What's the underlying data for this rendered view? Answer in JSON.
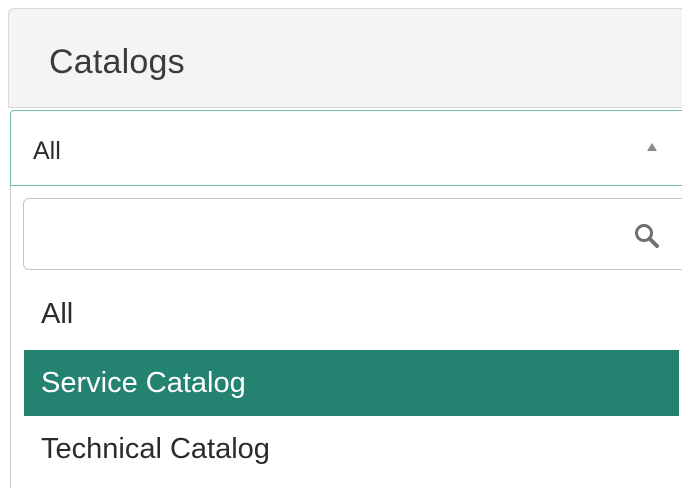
{
  "header": {
    "title": "Catalogs"
  },
  "select": {
    "value": "All",
    "arrow_icon": "triangle-up-icon"
  },
  "dropdown": {
    "search": {
      "value": "",
      "placeholder": "",
      "icon": "search-icon"
    },
    "options": [
      {
        "label": "All",
        "selected": false
      },
      {
        "label": "Service Catalog",
        "selected": true
      },
      {
        "label": "Technical Catalog",
        "selected": false
      }
    ]
  },
  "colors": {
    "header_bg": "#f4f4f4",
    "highlight": "#248270",
    "select_border": "#7ab8ae",
    "text": "#2b2b2b"
  }
}
